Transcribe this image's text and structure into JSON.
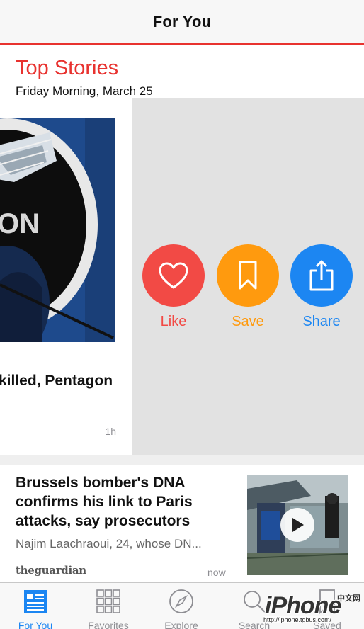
{
  "navbar": {
    "title": "For You"
  },
  "section": {
    "title": "Top Stories",
    "date": "Friday Morning, March 25"
  },
  "featured": {
    "headline_fragment": "killed, Pentagon",
    "time": "1h"
  },
  "actions": [
    {
      "label": "Like",
      "icon": "heart-icon",
      "color": "#f24a45"
    },
    {
      "label": "Save",
      "icon": "bookmark-icon",
      "color": "#ff9a0e"
    },
    {
      "label": "Share",
      "icon": "share-icon",
      "color": "#1c86f2"
    }
  ],
  "story": {
    "headline": "Brussels bomber's DNA confirms his link to Paris attacks, say prosecutors",
    "excerpt": "Najim Laachraoui, 24, whose DN...",
    "source": "theguardian",
    "time": "now"
  },
  "tabbar": {
    "tabs": [
      {
        "label": "For You",
        "icon": "news-icon",
        "active": true
      },
      {
        "label": "Favorites",
        "icon": "grid-icon",
        "active": false
      },
      {
        "label": "Explore",
        "icon": "compass-icon",
        "active": false
      },
      {
        "label": "Search",
        "icon": "search-icon",
        "active": false
      },
      {
        "label": "Saved",
        "icon": "bookmark-icon",
        "active": false
      }
    ]
  },
  "watermark": {
    "brand": "iPhone",
    "cn": "中文网",
    "url": "http://iphone.tgbus.com/"
  },
  "colors": {
    "accent": "#e8322f",
    "link": "#1c86f2"
  }
}
